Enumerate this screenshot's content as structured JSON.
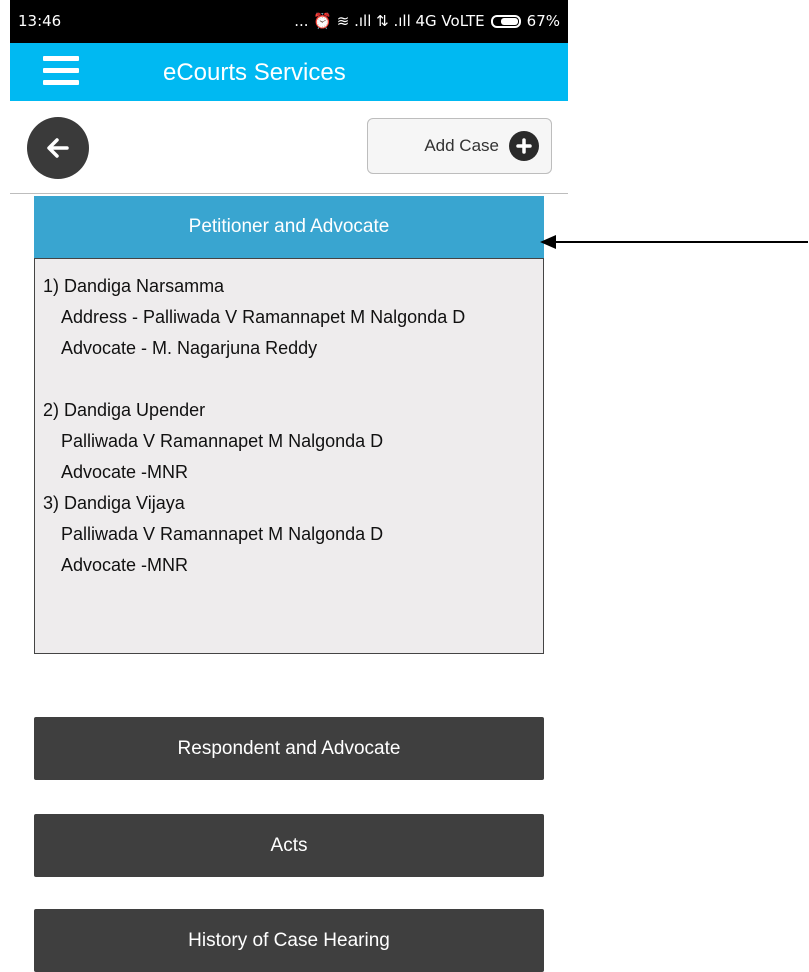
{
  "status_bar": {
    "time": "13:46",
    "indicators": "... ⏰ ≋ .ıll ⇅ .ıll 4G VoLTE",
    "battery": "67%"
  },
  "app_bar": {
    "title": "eCourts Services"
  },
  "toolbar": {
    "add_case_label": "Add Case"
  },
  "sections": {
    "petitioner": {
      "header": "Petitioner and Advocate",
      "parties": [
        {
          "name": "1) Dandiga Narsamma",
          "address": "Address - Palliwada V Ramannapet M Nalgonda D",
          "advocate": "Advocate - M. Nagarjuna Reddy"
        },
        {
          "name": "2) Dandiga Upender",
          "address": "Palliwada V Ramannapet M Nalgonda D",
          "advocate": "Advocate -MNR"
        },
        {
          "name": "3) Dandiga Vijaya",
          "address": "Palliwada V Ramannapet M Nalgonda D",
          "advocate": "Advocate -MNR"
        }
      ]
    },
    "respondent": {
      "header": "Respondent and Advocate"
    },
    "acts": {
      "header": "Acts"
    },
    "history": {
      "header": "History of Case Hearing"
    }
  },
  "colors": {
    "app_bar": "#00b9f2",
    "section_active": "#39a5d0",
    "section_dark": "#3f3f3f",
    "panel_bg": "#eeeced"
  }
}
